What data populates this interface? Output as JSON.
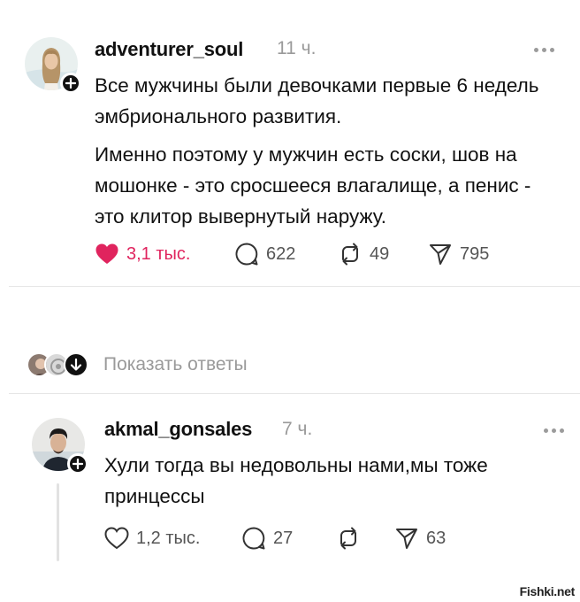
{
  "post": {
    "username": "adventurer_soul",
    "time": "11 ч.",
    "paragraphs": [
      "Все мужчины были девочками первые 6 недель эмбрионального развития.",
      "Именно поэтому у мужчин есть соски, шов на мошонке - это сросшееся влагалище, а пенис - это клитор вывернутый наружу."
    ],
    "likes": "3,1 тыс.",
    "comments": "622",
    "reposts": "49",
    "shares": "795",
    "liked_color": "#e0245e"
  },
  "replies_link": {
    "label": "Показать ответы"
  },
  "reply": {
    "username": "akmal_gonsales",
    "time": "7 ч.",
    "text": "Хули тогда вы недовольны нами,мы тоже принцессы",
    "likes": "1,2 тыс.",
    "comments": "27",
    "shares": "63"
  },
  "watermark": "Fishki.net",
  "icons": [
    "plus-icon",
    "more-icon",
    "heart-icon",
    "comment-icon",
    "repost-icon",
    "share-icon",
    "arrow-down-icon"
  ]
}
